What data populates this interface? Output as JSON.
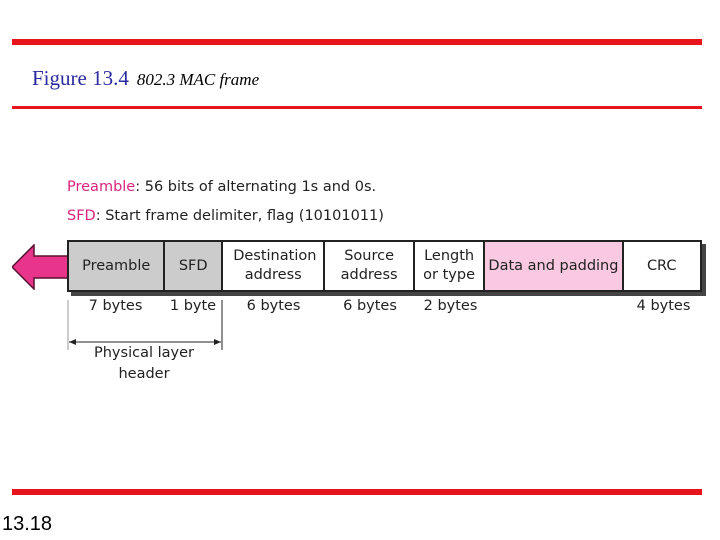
{
  "title": {
    "figure": "Figure 13.4",
    "caption": "802.3 MAC frame"
  },
  "legend": [
    {
      "term": "Preamble",
      "text": ": 56 bits of alternating 1s and 0s."
    },
    {
      "term": "SFD",
      "text": ": Start frame delimiter, flag (10101011)"
    }
  ],
  "fields": [
    {
      "label": "Preamble",
      "size": "7 bytes",
      "fill": "#cccccc"
    },
    {
      "label": "SFD",
      "size": "1 byte",
      "fill": "#cccccc"
    },
    {
      "label": "Destination address",
      "size": "6 bytes",
      "fill": "#ffffff"
    },
    {
      "label": "Source address",
      "size": "6 bytes",
      "fill": "#ffffff"
    },
    {
      "label": "Length or type",
      "size": "2 bytes",
      "fill": "#ffffff"
    },
    {
      "label": "Data and padding",
      "size": "",
      "fill": "#f9c9e1"
    },
    {
      "label": "CRC",
      "size": "4 bytes",
      "fill": "#ffffff"
    }
  ],
  "physical_header_label": "Physical layer header",
  "arrow_color": "#e8348a",
  "accent_color": "#e8141b",
  "page_number": "13.18"
}
